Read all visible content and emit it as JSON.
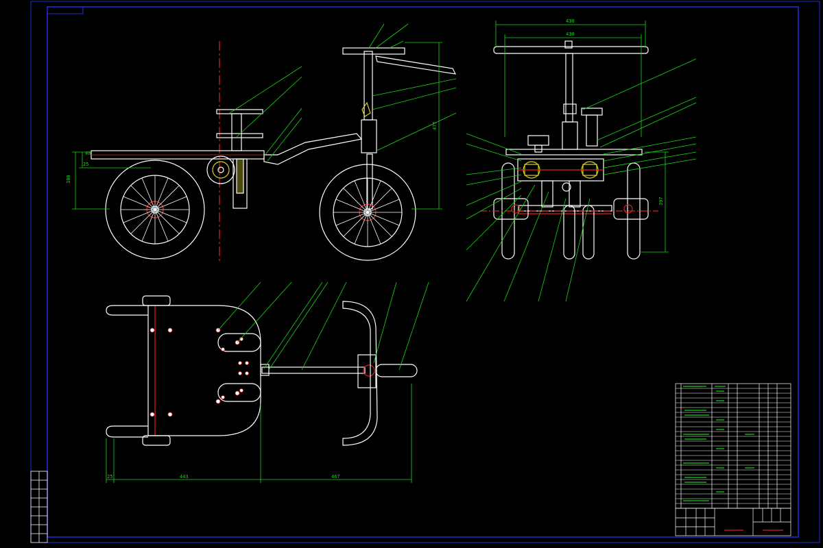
{
  "colors": {
    "background": "#000000",
    "frame": "#1f2fd8",
    "outline": "#ffffff",
    "dimension": "#18d818",
    "centerline": "#e02020",
    "hatch": "#d8d020"
  },
  "dimensions": {
    "front_width": "430",
    "front_inner_width": "430",
    "side_height": "477",
    "front_height": "397",
    "side_small": "40",
    "side_small2": "25",
    "side_vertical": "180",
    "plan_left": "25",
    "plan_middle": "443",
    "plan_right": "467"
  },
  "title_block": {
    "drawing_title": "",
    "company": ""
  },
  "icons": {
    "wheel": "spoked-wheel-icon",
    "handlebar": "handlebar-icon"
  }
}
